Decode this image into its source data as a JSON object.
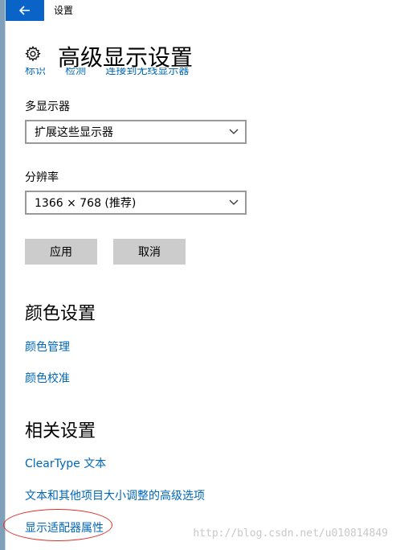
{
  "window": {
    "app_title": "设置",
    "page_title": "高级显示设置",
    "clipped_links": [
      "标识",
      "检测",
      "连接到无线显示器"
    ]
  },
  "multi_display": {
    "label": "多显示器",
    "selected": "扩展这些显示器"
  },
  "resolution": {
    "label": "分辨率",
    "selected": "1366 × 768 (推荐)"
  },
  "actions": {
    "apply_label": "应用",
    "cancel_label": "取消"
  },
  "color_settings": {
    "title": "颜色设置",
    "links": [
      "颜色管理",
      "颜色校准"
    ]
  },
  "related_settings": {
    "title": "相关设置",
    "links": [
      "ClearType 文本",
      "文本和其他项目大小调整的高级选项",
      "显示适配器属性"
    ]
  },
  "watermark": "http://blog.csdn.net/u010814849",
  "colors": {
    "accent": "#0a64c8",
    "link": "#0067b8",
    "button_bg": "#cccccc",
    "annotation": "#e0302a"
  }
}
